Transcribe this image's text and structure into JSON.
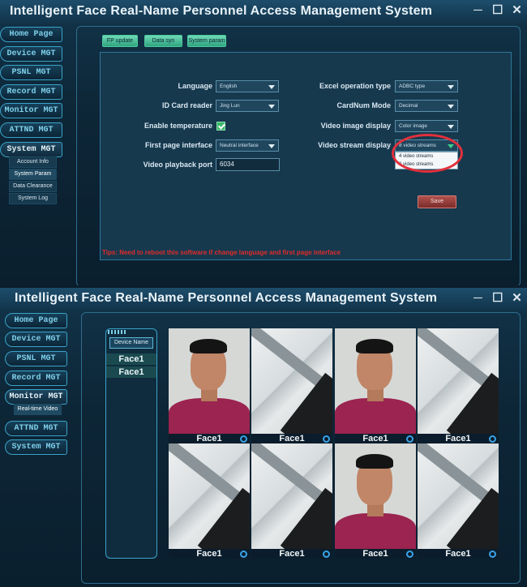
{
  "top_window": {
    "title": "Intelligent Face Real-Name Personnel Access Management System",
    "controls": {
      "minimize": "─",
      "maximize": "☐",
      "close": "✕"
    },
    "nav": [
      "Home Page",
      "Device MGT",
      "PSNL MGT",
      "Record MGT",
      "Monitor MGT",
      "ATTND MGT",
      "System MGT"
    ],
    "active_nav": "System MGT",
    "sub_nav": [
      "Account Info",
      "System Param",
      "Data Clearance",
      "System Log"
    ],
    "selected_sub": "System Param",
    "tabs": [
      "FP update",
      "Data syn",
      "System param"
    ],
    "form": {
      "language_label": "Language",
      "language_value": "English",
      "id_reader_label": "ID Card reader",
      "id_reader_value": "Jing Lun",
      "temp_label": "Enable temperature",
      "temp_checked": true,
      "first_page_label": "First page interface",
      "first_page_value": "Neutral interface",
      "playback_label": "Video playback port",
      "playback_value": "6034",
      "excel_label": "Excel operation type",
      "excel_value": "ADBC type",
      "cardnum_label": "CardNum Mode",
      "cardnum_value": "Decimal",
      "image_display_label": "Video image display",
      "image_display_value": "Color image",
      "stream_label": "Video stream display",
      "stream_value": "8 video streams",
      "stream_options": [
        "4 video streams",
        "8 video streams"
      ]
    },
    "save_label": "Save",
    "tips": "Tips: Need to reboot this software if change language and first page interface"
  },
  "bottom_window": {
    "title": "Intelligent Face Real-Name Personnel Access Management System",
    "controls": {
      "minimize": "─",
      "maximize": "☐",
      "close": "✕"
    },
    "nav": [
      "Home Page",
      "Device MGT",
      "PSNL MGT",
      "Record MGT",
      "Monitor MGT",
      "ATTND MGT",
      "System MGT"
    ],
    "active_nav": "Monitor MGT",
    "sub_nav": [
      "Real-time Video"
    ],
    "device_header": "Device Name",
    "devices": [
      "Face1",
      "Face1"
    ],
    "video_cells": [
      {
        "caption": "Face1",
        "content": "face"
      },
      {
        "caption": "Face1",
        "content": "ceiling"
      },
      {
        "caption": "Face1",
        "content": "face"
      },
      {
        "caption": "Face1",
        "content": "ceiling"
      },
      {
        "caption": "Face1",
        "content": "ceiling"
      },
      {
        "caption": "Face1",
        "content": "ceiling"
      },
      {
        "caption": "Face1",
        "content": "face"
      },
      {
        "caption": "Face1",
        "content": "ceiling"
      }
    ]
  },
  "colors": {
    "accent": "#3aa3c8",
    "tab_green": "#2fa57f",
    "tips_red": "#e12b2b",
    "highlight_circle": "#e2303c"
  }
}
